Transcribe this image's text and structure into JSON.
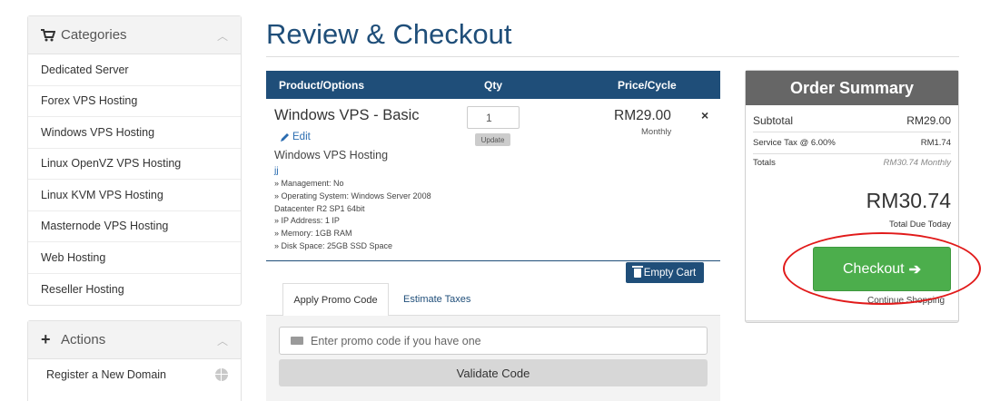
{
  "sidebar": {
    "categories_title": "Categories",
    "categories": [
      "Dedicated Server",
      "Forex VPS Hosting",
      "Windows VPS Hosting",
      "Linux OpenVZ VPS Hosting",
      "Linux KVM VPS Hosting",
      "Masternode VPS Hosting",
      "Web Hosting",
      "Reseller Hosting"
    ],
    "actions_title": "Actions",
    "actions": [
      "Register a New Domain"
    ]
  },
  "page_title": "Review & Checkout",
  "cart": {
    "headers": {
      "product": "Product/Options",
      "qty": "Qty",
      "price": "Price/Cycle"
    },
    "item": {
      "name": "Windows VPS - Basic",
      "edit_label": "Edit",
      "group": "Windows VPS Hosting",
      "domain": "jj",
      "details": [
        "» Management: No",
        "» Operating System: Windows Server 2008 Datacenter R2 SP1 64bit",
        "» IP Address: 1 IP",
        "» Memory: 1GB RAM",
        "» Disk Space: 25GB SSD Space"
      ],
      "qty": "1",
      "update_label": "Update",
      "price": "RM29.00",
      "cycle": "Monthly",
      "remove_symbol": "×"
    },
    "empty_cart_label": "Empty Cart"
  },
  "promo": {
    "tabs": [
      "Apply Promo Code",
      "Estimate Taxes"
    ],
    "placeholder": "Enter promo code if you have one",
    "validate_label": "Validate Code"
  },
  "summary": {
    "title": "Order Summary",
    "subtotal_label": "Subtotal",
    "subtotal_value": "RM29.00",
    "tax_label": "Service Tax @ 6.00%",
    "tax_value": "RM1.74",
    "totals_label": "Totals",
    "totals_value": "RM30.74 Monthly",
    "total_due": "RM30.74",
    "total_due_label": "Total Due Today",
    "checkout_label": "Checkout",
    "continue_label": "Continue Shopping"
  },
  "colors": {
    "brand_blue": "#1f4e79",
    "checkout_green": "#4cae4c",
    "annotation_red": "#e11a1a"
  }
}
